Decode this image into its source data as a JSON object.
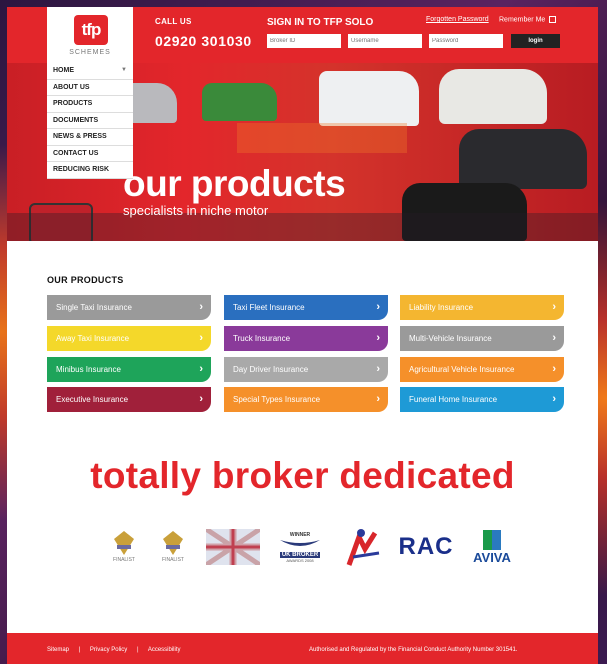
{
  "header": {
    "logo_text": "tfp",
    "logo_sub": "SCHEMES",
    "call_label": "CALL US",
    "phone": "02920 301030",
    "signin_title": "SIGN IN TO TFP SOLO",
    "forgotten_password": "Forgotten Password",
    "remember_me": "Remember Me",
    "broker_id_placeholder": "Broker ID",
    "username_placeholder": "Username",
    "password_placeholder": "Password",
    "login_label": "login"
  },
  "nav": {
    "items": [
      {
        "label": "HOME"
      },
      {
        "label": "ABOUT US"
      },
      {
        "label": "PRODUCTS"
      },
      {
        "label": "DOCUMENTS"
      },
      {
        "label": "NEWS & PRESS"
      },
      {
        "label": "CONTACT US"
      },
      {
        "label": "REDUCING RISK"
      }
    ]
  },
  "hero": {
    "title": "our products",
    "subtitle": "specialists in niche motor"
  },
  "products": {
    "title": "OUR PRODUCTS",
    "items": [
      {
        "label": "Single Taxi Insurance",
        "color": "#9a9a9a"
      },
      {
        "label": "Taxi Fleet Insurance",
        "color": "#2a6fbf"
      },
      {
        "label": "Liability Insurance",
        "color": "#f4b630"
      },
      {
        "label": "Away Taxi Insurance",
        "color": "#f4d82a"
      },
      {
        "label": "Truck Insurance",
        "color": "#8a3a9a"
      },
      {
        "label": "Multi-Vehicle Insurance",
        "color": "#9a9a9a"
      },
      {
        "label": "Minibus Insurance",
        "color": "#1ea45a"
      },
      {
        "label": "Day Driver Insurance",
        "color": "#a9a9a9"
      },
      {
        "label": "Agricultural Vehicle Insurance",
        "color": "#f5902a"
      },
      {
        "label": "Executive Insurance",
        "color": "#a0203a"
      },
      {
        "label": "Special Types Insurance",
        "color": "#f5902a"
      },
      {
        "label": "Funeral Home Insurance",
        "color": "#1e9ad6"
      }
    ]
  },
  "tagline": "totally broker dedicated",
  "awards": {
    "finalist_1": "FINALIST",
    "finalist_2": "FINALIST",
    "uk_broker_top": "WINNER",
    "uk_broker_main": "UK BROKER",
    "uk_broker_sub": "AWARDS 2008",
    "rac": "RAC",
    "aviva": "AVIVA"
  },
  "footer": {
    "sitemap": "Sitemap",
    "privacy": "Privacy Policy",
    "accessibility": "Accessibility",
    "separator": "|",
    "legal": "Authorised and Regulated by the Financial Conduct Authority Number 301541."
  },
  "colors": {
    "brand_red": "#e3262b",
    "dark": "#222222"
  }
}
